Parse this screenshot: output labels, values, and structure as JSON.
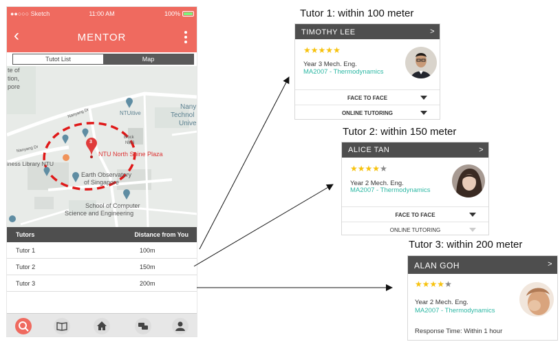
{
  "phone": {
    "status": {
      "carrier": "●●○○○ Sketch",
      "time": "11:00 AM",
      "battery": "100%"
    },
    "nav": {
      "back": "‹",
      "title": "MENTOR"
    },
    "segment": {
      "left": "Tutot List",
      "right": "Map"
    },
    "map_labels": {
      "l1": "te of",
      "l2": "tion,",
      "l3": "pore",
      "nanyang1": "Nanyang Dr",
      "ntuitive": "NTUitive",
      "nany": "Nany",
      "technol": "Technol",
      "univ": "Unive",
      "block": "Block",
      "n3": "NW3",
      "nanyang2": "Nanyang Dr",
      "spine": "NTU North Spine Plaza",
      "library": "iness Library NTU",
      "earth1": "Earth Observatory",
      "earth2": "of Singapore",
      "soc1": "School of Computer",
      "soc2": "Science and Engineering",
      "pin_number": "3"
    },
    "table": {
      "col1": "Tutors",
      "col2": "Distance from You",
      "rows": [
        {
          "name": "Tutor 1",
          "distance": "100m"
        },
        {
          "name": "Tutor 2",
          "distance": "150m"
        },
        {
          "name": "Tutor 3",
          "distance": "200m"
        }
      ]
    },
    "tabs": [
      "search-icon",
      "book-icon",
      "home-icon",
      "chat-icon",
      "profile-icon"
    ]
  },
  "captions": {
    "c1": "Tutor 1: within 100 meter",
    "c2": "Tutor 2: within 150 meter",
    "c3": "Tutor 3: within 200 meter"
  },
  "cards": [
    {
      "name": "TIMOTHY LEE",
      "chevron": ">",
      "rating": 5,
      "year": "Year 3 Mech. Eng.",
      "module": "MA2007 - Thermodynamics",
      "opt1": "FACE TO FACE",
      "opt2": "ONLINE TUTORING"
    },
    {
      "name": "ALICE TAN",
      "chevron": ">",
      "rating": 4,
      "year": "Year 2 Mech. Eng.",
      "module": "MA2007 - Thermodynamics",
      "opt1": "FACE TO FACE",
      "opt2": "ONLINE TUTORING"
    },
    {
      "name": "ALAN GOH",
      "chevron": ">",
      "rating": 4,
      "year": "Year 2 Mech. Eng.",
      "module": "MA2007 - Thermodynamics",
      "response": "Response Time: Within 1 hour"
    }
  ],
  "colors": {
    "accent": "#ef6a5f",
    "header": "#4e4e4e",
    "teal": "#2bb7a3",
    "star": "#f7c20d",
    "pin": "#e03b3b"
  }
}
